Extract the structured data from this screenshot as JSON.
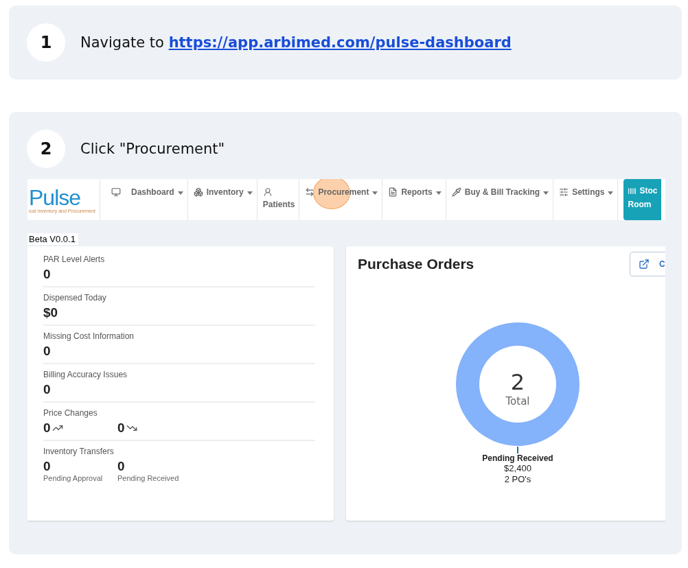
{
  "steps": [
    {
      "number": "1",
      "text": "Navigate to ",
      "link": "https://app.arbimed.com/pulse-dashboard"
    },
    {
      "number": "2",
      "text": "Click \"Procurement\""
    }
  ],
  "app": {
    "logo": {
      "name": "Pulse",
      "tagline": "ical Inventory and Procurement"
    },
    "nav": [
      {
        "label": "Dashboard",
        "dropdown": true,
        "clicked": false
      },
      {
        "label": "Inventory",
        "dropdown": true,
        "clicked": false
      },
      {
        "label": "Patients",
        "dropdown": false,
        "clicked": false
      },
      {
        "label": "Procurement",
        "dropdown": true,
        "clicked": true
      },
      {
        "label": "Reports",
        "dropdown": true,
        "clicked": false
      },
      {
        "label": "Buy & Bill Tracking",
        "dropdown": true,
        "clicked": false
      },
      {
        "label": "Settings",
        "dropdown": true,
        "clicked": false
      }
    ],
    "stock_room": {
      "label_top": "Stoc",
      "label_bottom": "Room"
    },
    "version": "Beta V0.0.1",
    "metrics": [
      {
        "kind": "single",
        "label": "PAR Level Alerts",
        "value": "0"
      },
      {
        "kind": "single",
        "label": "Dispensed Today",
        "value": "$0"
      },
      {
        "kind": "single",
        "label": "Missing Cost Information",
        "value": "0"
      },
      {
        "kind": "single",
        "label": "Billing Accuracy Issues",
        "value": "0"
      },
      {
        "kind": "trend",
        "label": "Price Changes",
        "up": "0",
        "down": "0"
      },
      {
        "kind": "pair",
        "label": "Inventory Transfers",
        "items": [
          {
            "value": "0",
            "caption": "Pending Approval"
          },
          {
            "value": "0",
            "caption": "Pending Received"
          }
        ]
      }
    ],
    "purchase_orders": {
      "title": "Purchase Orders",
      "button": "C",
      "total": "2",
      "total_label": "Total",
      "slice_label": {
        "name": "Pending Received",
        "amount": "$2,400",
        "count": "2 PO's"
      }
    }
  }
}
